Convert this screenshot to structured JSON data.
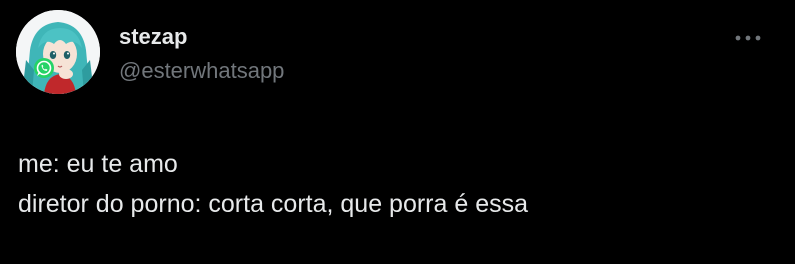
{
  "author": {
    "display_name": "stezap",
    "handle": "@esterwhatsapp",
    "avatar_icon": "avatar-anime-character-whatsapp-logo"
  },
  "menu": {
    "icon": "more-horizontal-icon"
  },
  "tweet": {
    "lines": [
      "me: eu te amo",
      "diretor do porno: corta corta, que porra é essa"
    ]
  },
  "colors": {
    "background": "#000000",
    "text_primary": "#e7e9ea",
    "text_secondary": "#71767b",
    "whatsapp_green": "#25d366",
    "hair_teal": "#3fb6b8"
  }
}
